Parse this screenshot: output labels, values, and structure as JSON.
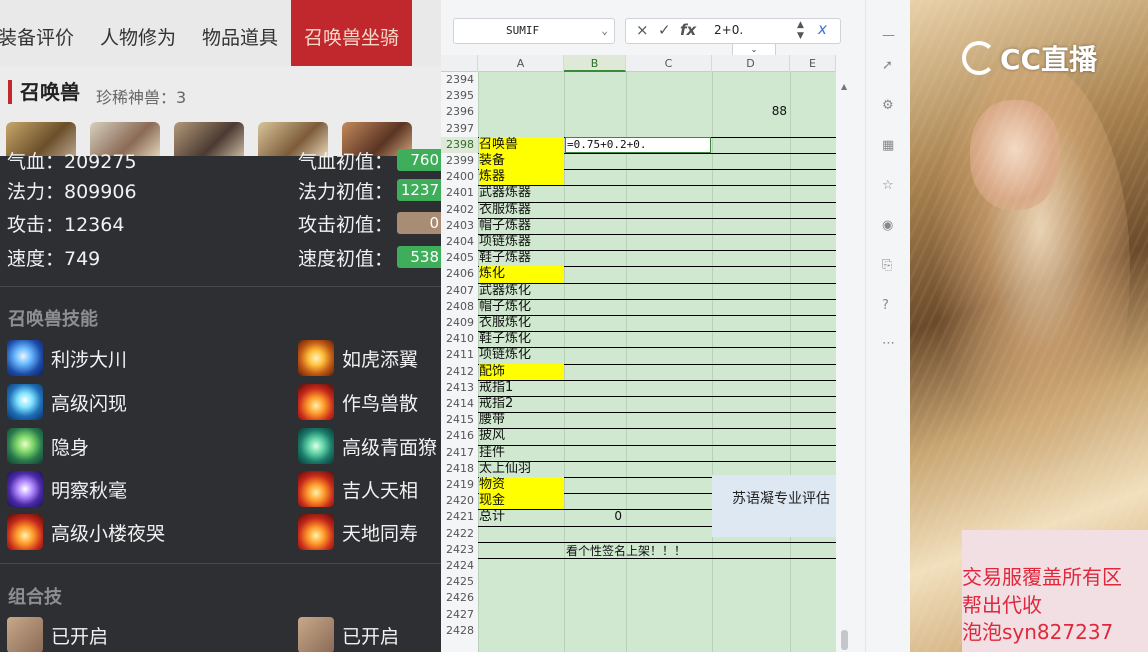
{
  "game": {
    "tabs": [
      "装备评价",
      "人物修为",
      "物品道具",
      "召唤兽坐骑"
    ],
    "pet_title": "召唤兽",
    "rare_label": "珍稀神兽：3",
    "stats": [
      {
        "label": "气血：209275",
        "init_label": "气血初值：",
        "init_value": "760",
        "color": "#3fae5a"
      },
      {
        "label": "法力：809906",
        "init_label": "法力初值：",
        "init_value": "1237",
        "color": "#3fae5a"
      },
      {
        "label": "攻击：12364",
        "init_label": "攻击初值：",
        "init_value": "0",
        "color": "#a88c74"
      },
      {
        "label": "速度：749",
        "init_label": "速度初值：",
        "init_value": "538",
        "color": "#3fae5a"
      }
    ],
    "skills_title": "召唤兽技能",
    "skills_left": [
      {
        "name": "利涉大川",
        "icon": "blue-wave-icon"
      },
      {
        "name": "高级闪现",
        "icon": "cyan-flash-icon"
      },
      {
        "name": "隐身",
        "icon": "green-stealth-icon"
      },
      {
        "name": "明察秋毫",
        "icon": "purple-eye-icon"
      },
      {
        "name": "高级小楼夜哭",
        "icon": "fire-night-icon"
      }
    ],
    "skills_right": [
      {
        "name": "如虎添翼",
        "icon": "gold-wing-icon"
      },
      {
        "name": "作鸟兽散",
        "icon": "fire-scatter-icon"
      },
      {
        "name": "高级青面獠",
        "icon": "teal-face-icon"
      },
      {
        "name": "吉人天相",
        "icon": "fire-luck-icon"
      },
      {
        "name": "天地同寿",
        "icon": "fire-life-icon"
      }
    ],
    "combo_title": "组合技",
    "combo_items": [
      "已开启",
      "已开启"
    ]
  },
  "sheet": {
    "name_box": "SUMIF",
    "formula_bar_value": "2+0.",
    "formula_icons": {
      "cancel": "×",
      "confirm": "✓",
      "fx": "fx"
    },
    "columns": [
      "A",
      "B",
      "C",
      "D",
      "E"
    ],
    "rows": [
      {
        "n": "2394",
        "a": "",
        "yellow": false
      },
      {
        "n": "2395",
        "a": "",
        "yellow": false
      },
      {
        "n": "2396",
        "a": "",
        "yellow": false,
        "d": "88"
      },
      {
        "n": "2397",
        "a": "",
        "yellow": false
      },
      {
        "n": "2398",
        "a": "召唤兽",
        "yellow": true
      },
      {
        "n": "2399",
        "a": "装备",
        "yellow": true
      },
      {
        "n": "2400",
        "a": "炼器",
        "yellow": true
      },
      {
        "n": "2401",
        "a": "武器炼器",
        "yellow": false
      },
      {
        "n": "2402",
        "a": "衣服炼器",
        "yellow": false
      },
      {
        "n": "2403",
        "a": "帽子炼器",
        "yellow": false
      },
      {
        "n": "2404",
        "a": "项链炼器",
        "yellow": false
      },
      {
        "n": "2405",
        "a": "鞋子炼器",
        "yellow": false
      },
      {
        "n": "2406",
        "a": "炼化",
        "yellow": true
      },
      {
        "n": "2407",
        "a": "武器炼化",
        "yellow": false
      },
      {
        "n": "2408",
        "a": "帽子炼化",
        "yellow": false
      },
      {
        "n": "2409",
        "a": "衣服炼化",
        "yellow": false
      },
      {
        "n": "2410",
        "a": "鞋子炼化",
        "yellow": false
      },
      {
        "n": "2411",
        "a": "项链炼化",
        "yellow": false
      },
      {
        "n": "2412",
        "a": "配饰",
        "yellow": true
      },
      {
        "n": "2413",
        "a": "戒指1",
        "yellow": false
      },
      {
        "n": "2414",
        "a": "戒指2",
        "yellow": false
      },
      {
        "n": "2415",
        "a": "腰带",
        "yellow": false
      },
      {
        "n": "2416",
        "a": "披风",
        "yellow": false
      },
      {
        "n": "2417",
        "a": "挂件",
        "yellow": false
      },
      {
        "n": "2418",
        "a": "太上仙羽",
        "yellow": false
      },
      {
        "n": "2419",
        "a": "物资",
        "yellow": true
      },
      {
        "n": "2420",
        "a": "现金",
        "yellow": true
      },
      {
        "n": "2421",
        "a": "总计",
        "yellow": false,
        "b": "0"
      },
      {
        "n": "2422",
        "a": "",
        "yellow": false
      },
      {
        "n": "2423",
        "a": "",
        "yellow": false,
        "bc": "看个性签名上架！！！"
      },
      {
        "n": "2424",
        "a": "",
        "yellow": false
      },
      {
        "n": "2425",
        "a": "",
        "yellow": false
      },
      {
        "n": "2426",
        "a": "",
        "yellow": false
      },
      {
        "n": "2427",
        "a": "",
        "yellow": false
      },
      {
        "n": "2428",
        "a": "",
        "yellow": false
      }
    ],
    "editing_cell_text": "=0.75+0.2+0.",
    "note_text": "苏语凝专业评估"
  },
  "stream": {
    "logo_text": "CC直播",
    "ad_lines": [
      "交易服覆盖所有区",
      "帮出代收",
      "泡泡syn827237"
    ]
  }
}
